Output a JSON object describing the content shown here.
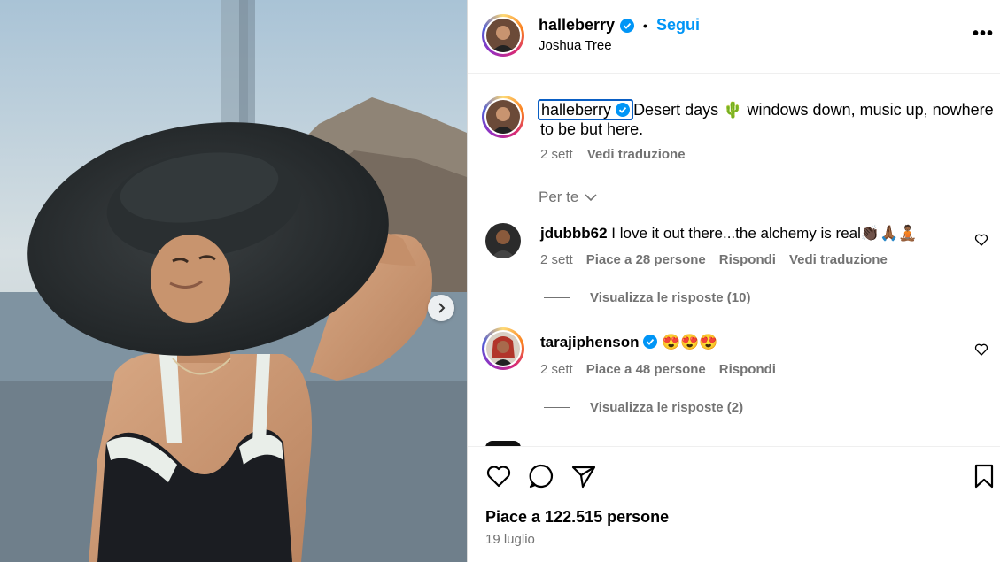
{
  "post": {
    "author": "halleberry",
    "follow_label": "Segui",
    "location": "Joshua Tree",
    "separator": "•",
    "more_label": "•••"
  },
  "caption": {
    "username": "halleberry",
    "text": "Desert days 🌵 windows down, music up, nowhere to be but here.",
    "time": "2 sett",
    "translate_label": "Vedi traduzione"
  },
  "section": {
    "for_you_label": "Per te"
  },
  "comments": [
    {
      "username": "jdubbb62",
      "text": "I love it out there...the alchemy is real👏🏿🙏🏾🧘🏾",
      "time": "2 sett",
      "likes_label": "Piace a 28 persone",
      "reply_label": "Rispondi",
      "translate_label": "Vedi traduzione",
      "view_replies_label": "Visualizza le risposte (10)"
    },
    {
      "username": "tarajiphenson",
      "text": "😍😍😍",
      "time": "2 sett",
      "likes_label": "Piace a 48 persone",
      "reply_label": "Rispondi",
      "view_replies_label": "Visualizza le risposte (2)"
    }
  ],
  "footer": {
    "likes": "Piace a 122.515 persone",
    "date": "19 luglio"
  },
  "colors": {
    "accent": "#0095f6",
    "secondary_text": "#737373",
    "verified": "#0095f6"
  }
}
